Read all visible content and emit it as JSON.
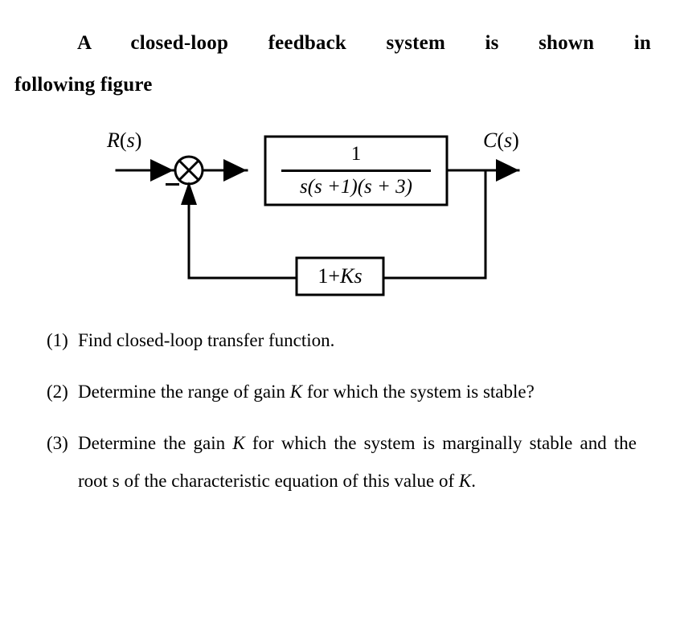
{
  "document": {
    "heading": {
      "line1": "A  closed-loop   feedback   system   is   shown   in",
      "line2": "following figure",
      "full_text": "A closed-loop feedback system is shown in following figure"
    },
    "figure": {
      "caption_alt": "Closed-loop feedback control block diagram",
      "input_label": "R(s)",
      "input_label_parts": {
        "var": "R",
        "open": "(",
        "arg": "s",
        "close": ")"
      },
      "output_label": "C(s)",
      "output_label_parts": {
        "var": "C",
        "open": "(",
        "arg": "s",
        "close": ")"
      },
      "summing_junction": {
        "name": "summing-junction",
        "glyph": "crossed-circle",
        "feedback_sign": "−",
        "input_sign": "+"
      },
      "forward_block": {
        "numerator": "1",
        "denominator": "s(s +1)(s + 3)",
        "denominator_parts": [
          "s",
          "(",
          "s",
          "+1",
          ")",
          "(",
          "s",
          "+ 3",
          ")"
        ],
        "transfer_function": "1 / [s(s+1)(s+3)]"
      },
      "feedback_block": {
        "label": "1+ Ks",
        "label_parts": {
          "constant": "1+ ",
          "gain": "K",
          "variable": "s"
        }
      }
    },
    "questions": [
      {
        "marker": "(1)",
        "text": "Find closed-loop transfer function.",
        "justified": false
      },
      {
        "marker": "(2)",
        "text_before_symbol": "Determine the range of gain ",
        "symbol": "K",
        "text_after_symbol": " for which the system is stable?",
        "text": "Determine the range of gain K for which the system is stable?",
        "justified": true
      },
      {
        "marker": "(3)",
        "text_before_symbol": "Determine the gain ",
        "symbol": "K",
        "text_after_symbol": " for which the system is marginally stable and the root s of the characteristic equation of this value of ",
        "symbol_end": "K",
        "text_end": ".",
        "text": "Determine the gain K for which the system is marginally stable and the root s of the characteristic equation of this value of K.",
        "justified": true
      }
    ]
  },
  "colors": {
    "page_background": "#ffffff",
    "text": "#000000",
    "diagram_stroke": "#000000"
  }
}
